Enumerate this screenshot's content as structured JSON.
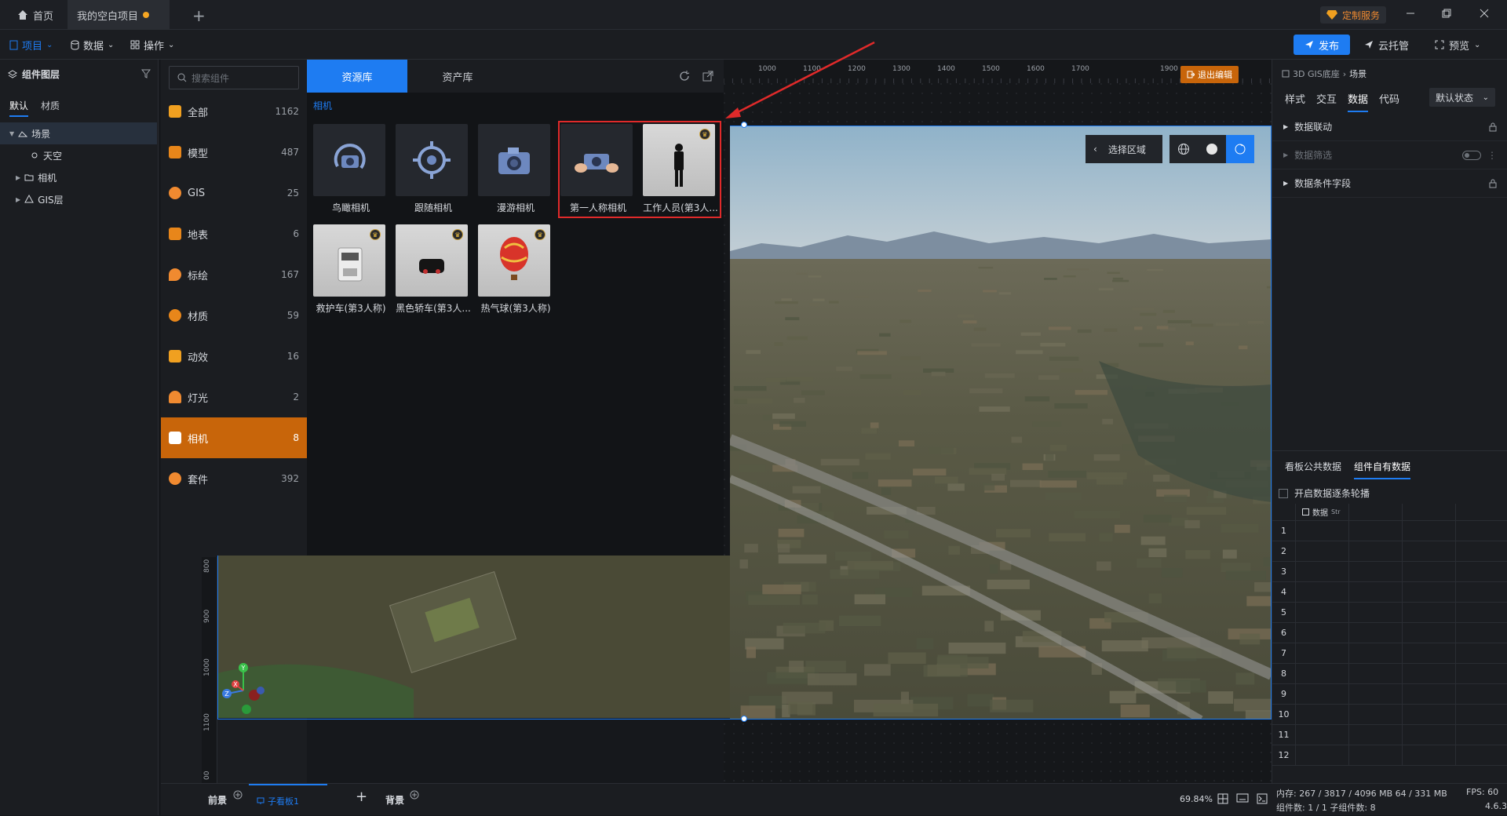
{
  "titlebar": {
    "home_label": "首页",
    "project_tab_label": "我的空白项目",
    "custom_service_label": "定制服务"
  },
  "menubar": {
    "project_label": "项目",
    "data_label": "数据",
    "operate_label": "操作",
    "publish_label": "发布",
    "cloud_label": "云托管",
    "preview_label": "预览"
  },
  "layers": {
    "title": "组件图层",
    "tab_default": "默认",
    "tab_material": "材质",
    "items": [
      {
        "label": "场景"
      },
      {
        "label": "天空"
      },
      {
        "label": "相机"
      },
      {
        "label": "GIS层"
      }
    ]
  },
  "search": {
    "placeholder": "搜索组件"
  },
  "categories": [
    {
      "label": "全部",
      "count": "1162",
      "color": "#f0a020"
    },
    {
      "label": "模型",
      "count": "487",
      "color": "#e8861a"
    },
    {
      "label": "GIS",
      "count": "25",
      "color": "#f08a30"
    },
    {
      "label": "地表",
      "count": "6",
      "color": "#e8861a"
    },
    {
      "label": "标绘",
      "count": "167",
      "color": "#f08a30"
    },
    {
      "label": "材质",
      "count": "59",
      "color": "#e8861a"
    },
    {
      "label": "动效",
      "count": "16",
      "color": "#f0a020"
    },
    {
      "label": "灯光",
      "count": "2",
      "color": "#f08a30"
    },
    {
      "label": "相机",
      "count": "8",
      "color": "#ffffff"
    },
    {
      "label": "套件",
      "count": "392",
      "color": "#f08a30"
    }
  ],
  "resource": {
    "tab_resources": "资源库",
    "tab_assets": "资产库",
    "section_title": "相机",
    "items": [
      {
        "label": "鸟瞰相机",
        "icon": "aerial-camera-icon"
      },
      {
        "label": "跟随相机",
        "icon": "follow-camera-icon"
      },
      {
        "label": "漫游相机",
        "icon": "roam-camera-icon"
      },
      {
        "label": "第一人称相机",
        "icon": "first-person-camera-icon"
      },
      {
        "label": "工作人员(第3人...",
        "icon": "worker-icon"
      },
      {
        "label": "救护车(第3人称)",
        "icon": "ambulance-icon"
      },
      {
        "label": "黑色轿车(第3人...",
        "icon": "black-car-icon"
      },
      {
        "label": "热气球(第3人称)",
        "icon": "hot-air-balloon-icon"
      }
    ]
  },
  "canvas": {
    "ruler_h": [
      "1000",
      "1100",
      "1200",
      "1300",
      "1400",
      "1500",
      "1600",
      "1700",
      "1900"
    ],
    "ruler_v": [
      "800",
      "900",
      "1000",
      "1100",
      "00"
    ],
    "exit_edit_label": "退出编辑",
    "select_area_label": "选择区域",
    "zoom_label": "69.84%"
  },
  "rightpanel": {
    "breadcrumb_parent": "3D GIS底座",
    "breadcrumb_current": "场景",
    "tabs": [
      "样式",
      "交互",
      "数据",
      "代码"
    ],
    "state_label": "默认状态",
    "rows": [
      "数据联动",
      "数据筛选",
      "数据条件字段"
    ],
    "data_tabs": [
      "看板公共数据",
      "组件自有数据"
    ],
    "carousel_label": "开启数据逐条轮播",
    "col_header": "数据",
    "col_sub": "Str",
    "row_numbers": [
      "1",
      "2",
      "3",
      "4",
      "5",
      "6",
      "7",
      "8",
      "9",
      "10",
      "11",
      "12"
    ]
  },
  "bottombar": {
    "front_label": "前景",
    "subboard_label": "子看板1",
    "background_label": "背景"
  },
  "status": {
    "memory": "内存: 267 / 3817 / 4096 MB  64 / 331 MB",
    "fps": "FPS: 60",
    "components": "组件数: 1 / 1   子组件数: 8",
    "version": "4.6.3"
  },
  "colors": {
    "accent": "#1e7cf2",
    "orange": "#c8650a",
    "highlight_red": "#e02a2a"
  }
}
